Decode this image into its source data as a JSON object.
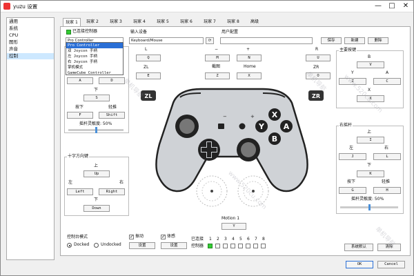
{
  "window": {
    "title": "yuzu 设置",
    "minimize": "—",
    "maximize": "□",
    "close": "✕"
  },
  "sidebar": {
    "items": [
      {
        "label": "通用"
      },
      {
        "label": "系统"
      },
      {
        "label": "CPU"
      },
      {
        "label": "图形"
      },
      {
        "label": "声音"
      },
      {
        "label": "控制"
      }
    ]
  },
  "tabs": [
    "玩家 1",
    "玩家 2",
    "玩家 3",
    "玩家 4",
    "玩家 5",
    "玩家 6",
    "玩家 7",
    "玩家 8",
    "高级"
  ],
  "connect": {
    "checkbox_label": "已连接控制器",
    "controller": "Pro Controller"
  },
  "dropdown": {
    "items": [
      "Pro Controller",
      "双 Joycon 手柄",
      "左 Joycon 手柄",
      "右 Joycon 手柄",
      "掌机模式",
      "GameCube Controller"
    ]
  },
  "input": {
    "label": "输入设备",
    "device": "Keyboard/Mouse",
    "refresh": "⟳"
  },
  "profile": {
    "label": "用户配置",
    "save": "保存",
    "new": "新建",
    "delete": "删除"
  },
  "top_buttons": {
    "l_label": "L",
    "l_key": "Q",
    "zl_label": "ZL",
    "zl_key": "E",
    "minus_label": "−",
    "minus_key": "M",
    "capture_label": "截图",
    "capture_key": "Z",
    "plus_label": "+",
    "plus_key": "N",
    "home_label": "Home",
    "home_key": "X",
    "r_label": "R",
    "r_key": "U",
    "zr_label": "ZR",
    "zr_key": "O"
  },
  "left_stick": {
    "left_key": "A",
    "right_key": "D",
    "down_label": "下",
    "down_key": "S",
    "press_label": "按下",
    "press_key": "F",
    "mod_label": "轻推",
    "mod_key": "Shift",
    "range_label": "摇杆灵敏度: 50%",
    "range_value": 0.5
  },
  "dpad": {
    "title": "十字方向键",
    "up_label": "上",
    "up_key": "Up",
    "left_label": "左",
    "left_key": "Left",
    "right_label": "右",
    "right_key": "Right",
    "down_label": "下",
    "down_key": "Down"
  },
  "face": {
    "title": "主要按键",
    "b_label": "B",
    "b_key": "V",
    "y_label": "Y",
    "y_key": "Z",
    "a_label": "A",
    "a_key": "C",
    "x_label": "X",
    "x_key": "X"
  },
  "controller_image": {
    "zl": "ZL",
    "zr": "ZR",
    "x": "X",
    "y": "Y",
    "a": "A",
    "b": "B"
  },
  "right_stick": {
    "title": "右摇杆",
    "up_label": "上",
    "up_key": "I",
    "left_label": "左",
    "left_key": "J",
    "right_label": "右",
    "right_key": "L",
    "down_label": "下",
    "down_key": "K",
    "press_label": "按下",
    "press_key": "G",
    "mod_label": "轻推",
    "mod_key": "H",
    "range_label": "摇杆灵敏度: 50%",
    "range_value": 0.5
  },
  "motion": {
    "label": "Motion 1",
    "key": "Y"
  },
  "console_mode": {
    "label": "控制台模式",
    "docked": "Docked",
    "undocked": "Undocked"
  },
  "vibration": {
    "label": "振动",
    "settings": "设置"
  },
  "motion_sensor": {
    "label": "体感",
    "settings": "设置"
  },
  "connected": {
    "label1": "已连接",
    "label2": "控制器",
    "numbers": [
      "1",
      "2",
      "3",
      "4",
      "5",
      "6",
      "7",
      "8"
    ]
  },
  "footer": {
    "defaults": "系统默认",
    "clear": "清除",
    "ok": "OK",
    "cancel": "Cancel"
  },
  "watermarks": [
    "单机导航",
    "www.520cu.com"
  ],
  "colors": {
    "accent": "#2a6fd6",
    "connected_green": "#33cc33",
    "controller_fill": "#cfd2d6",
    "controller_stroke": "#222"
  }
}
